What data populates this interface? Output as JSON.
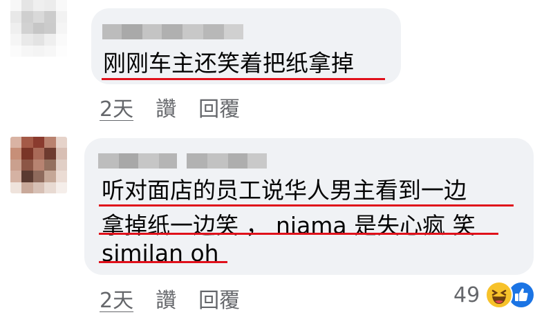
{
  "comments": [
    {
      "text": "刚刚车主还笑着把纸拿掉",
      "time": "2天",
      "like_label": "讚",
      "reply_label": "回覆"
    },
    {
      "lines": [
        "听对面店的员工说华人男主看到一边",
        "拿掉纸一边笑 ， niama 是失心疯 笑",
        "similan oh"
      ],
      "time": "2天",
      "like_label": "讚",
      "reply_label": "回覆",
      "reaction_count": "49",
      "reaction_icons": [
        "haha-icon",
        "like-icon"
      ]
    }
  ],
  "colors": {
    "bubble": "#f0f2f5",
    "underline": "#e0101a",
    "meta_text": "#65676b",
    "like_blue": "#1b74e4",
    "haha_yellow": "#f7c22a"
  }
}
